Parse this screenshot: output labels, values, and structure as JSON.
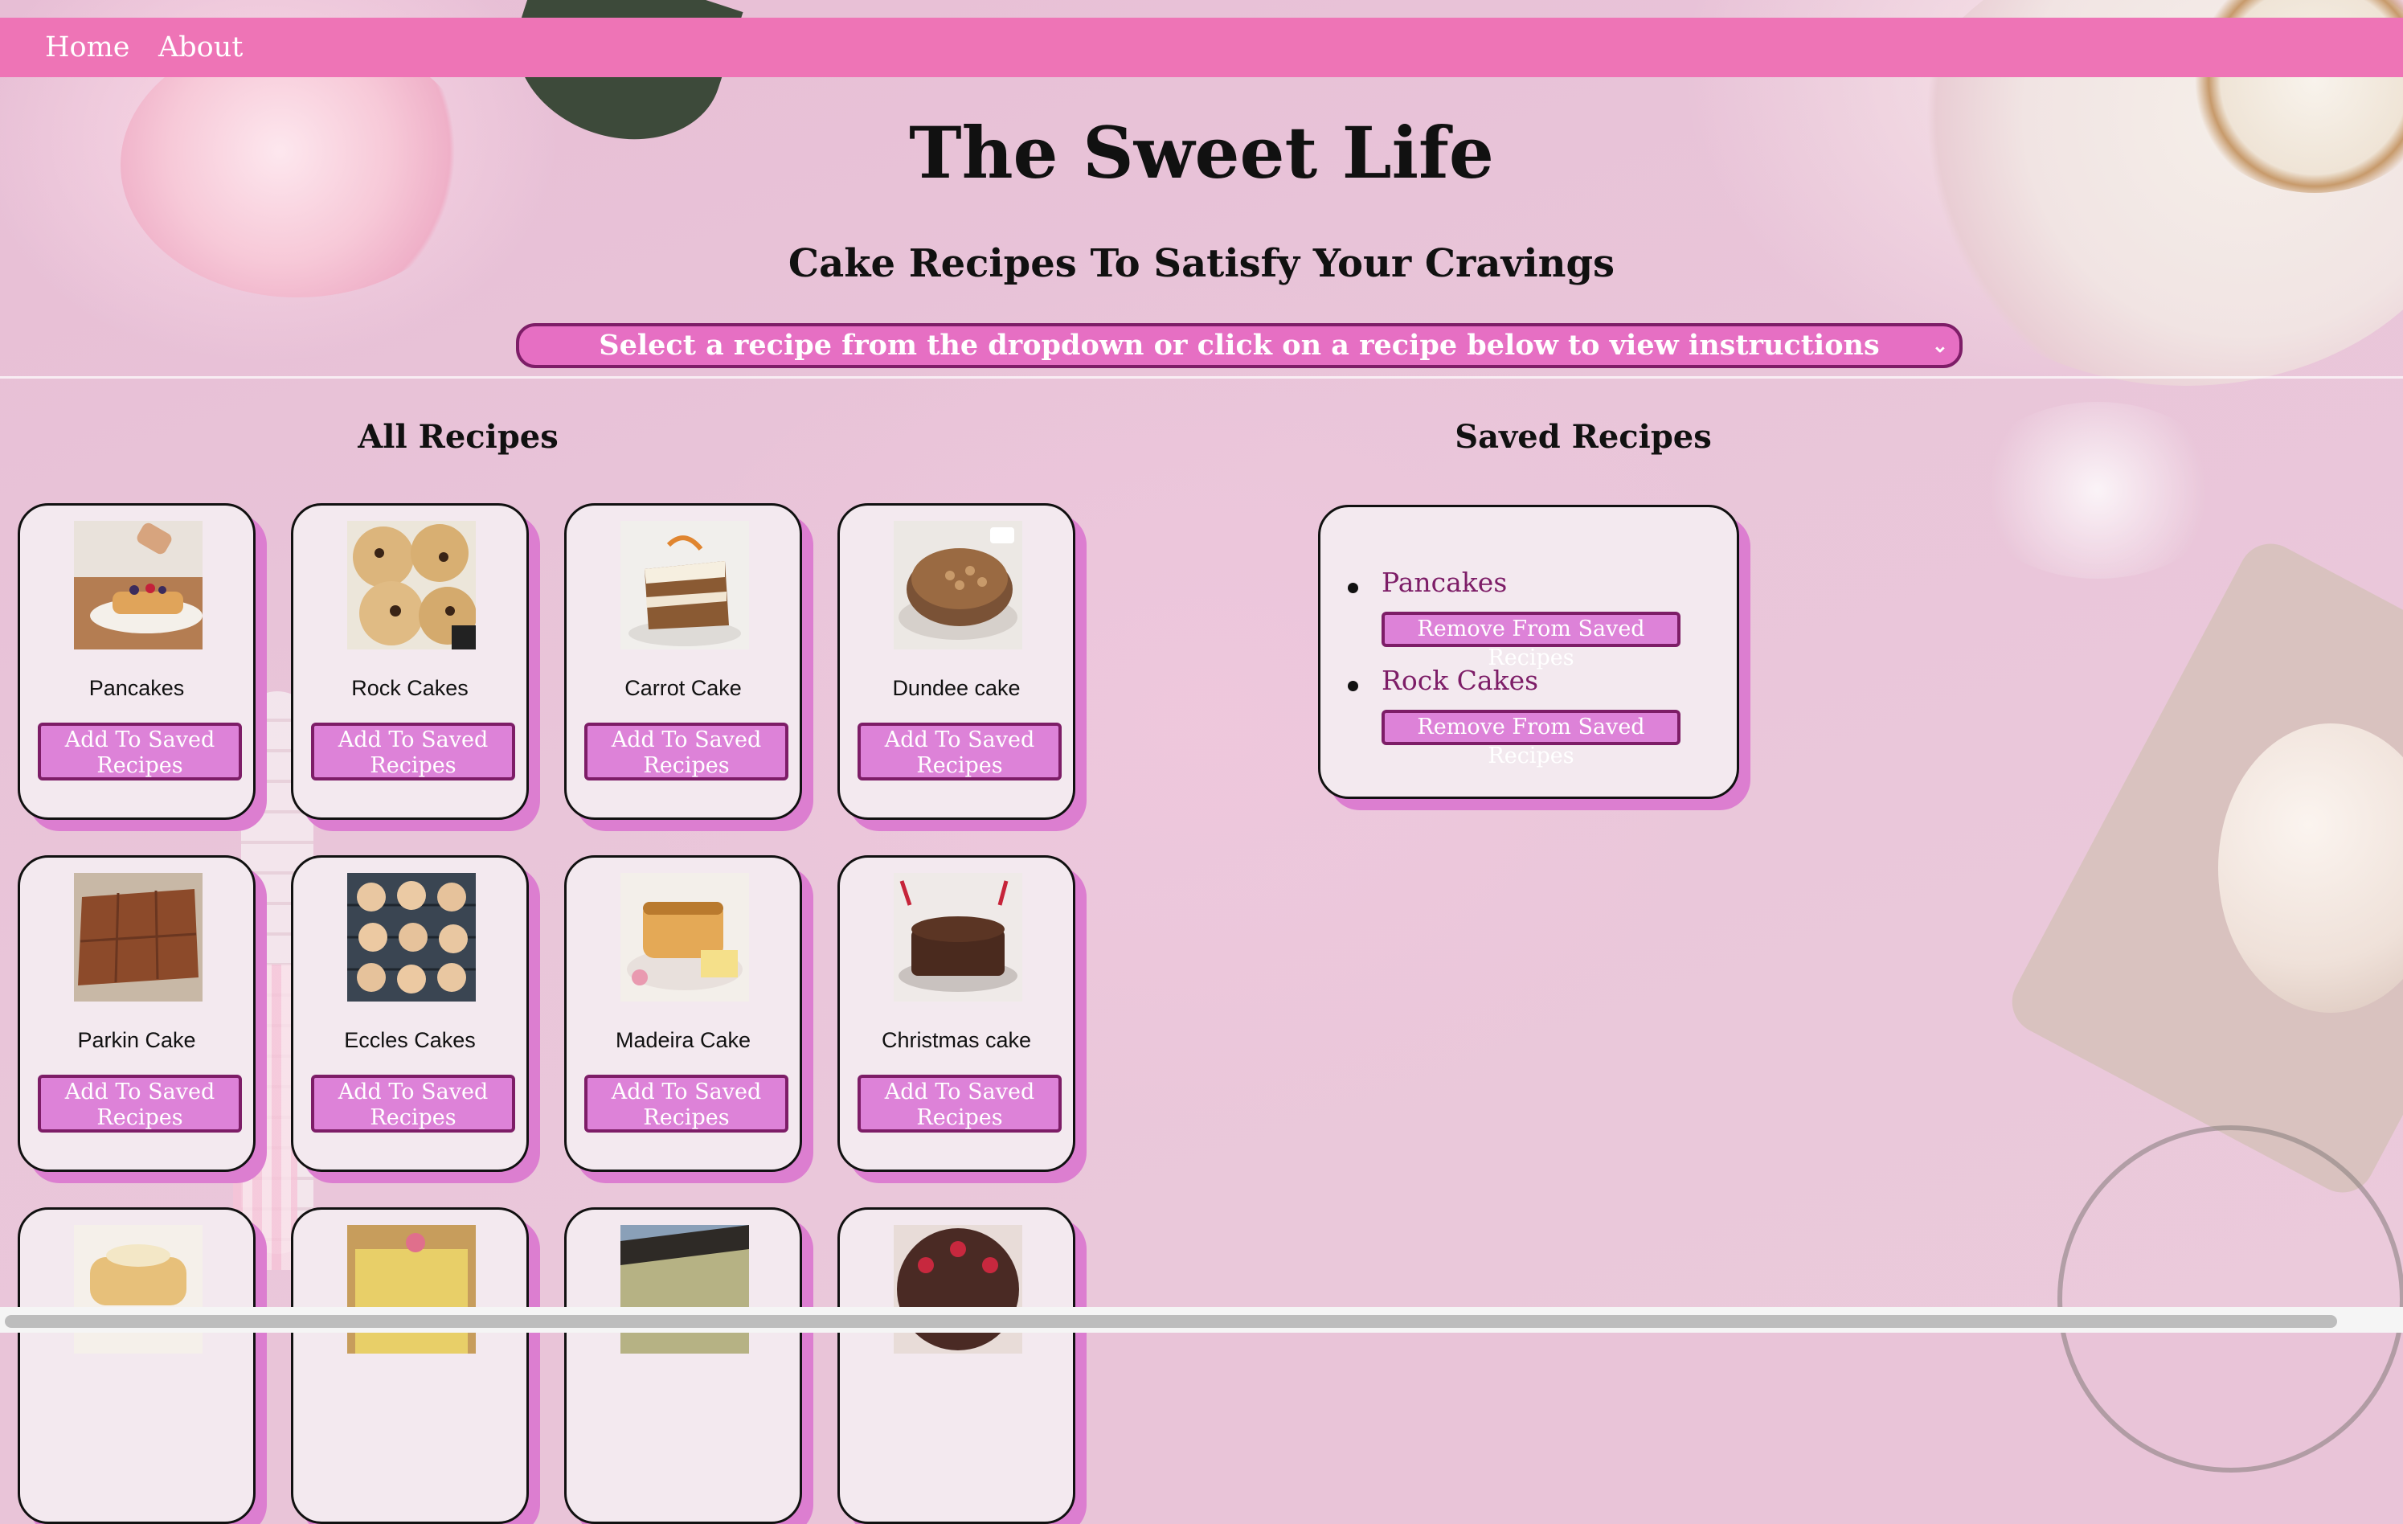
{
  "nav": {
    "links": [
      "Home",
      "About"
    ]
  },
  "header": {
    "title": "The Sweet Life",
    "subtitle": "Cake Recipes To Satisfy Your Cravings",
    "select_value": "Select a recipe from the dropdown or click on a recipe below to view instructions"
  },
  "all_recipes": {
    "title": "All Recipes",
    "add_label": "Add To Saved Recipes",
    "cards": [
      {
        "name": "Pancakes",
        "img": "pancakes-photo"
      },
      {
        "name": "Rock Cakes",
        "img": "rock-cakes-photo"
      },
      {
        "name": "Carrot Cake",
        "img": "carrot-cake-photo"
      },
      {
        "name": "Dundee cake",
        "img": "dundee-cake-photo"
      },
      {
        "name": "Parkin Cake",
        "img": "parkin-cake-photo"
      },
      {
        "name": "Eccles Cakes",
        "img": "eccles-cakes-photo"
      },
      {
        "name": "Madeira Cake",
        "img": "madeira-cake-photo"
      },
      {
        "name": "Christmas cake",
        "img": "christmas-cake-photo"
      },
      {
        "name": "",
        "img": "pancake-stack-photo"
      },
      {
        "name": "",
        "img": "battenberg-photo"
      },
      {
        "name": "",
        "img": "cheesecake-photo"
      },
      {
        "name": "",
        "img": "strawberry-chocolate-cake-photo"
      }
    ]
  },
  "saved_recipes": {
    "title": "Saved Recipes",
    "remove_label": "Remove From Saved Recipes",
    "items": [
      "Pancakes",
      "Rock Cakes"
    ]
  },
  "colors": {
    "nav_bg": "#ee74b6",
    "select_bg": "#e66fc3",
    "button_bg": "#dd82d8",
    "button_border": "#7d1d67",
    "card_bg": "#f3e9ef",
    "card_shadow": "#dc7ed0"
  }
}
